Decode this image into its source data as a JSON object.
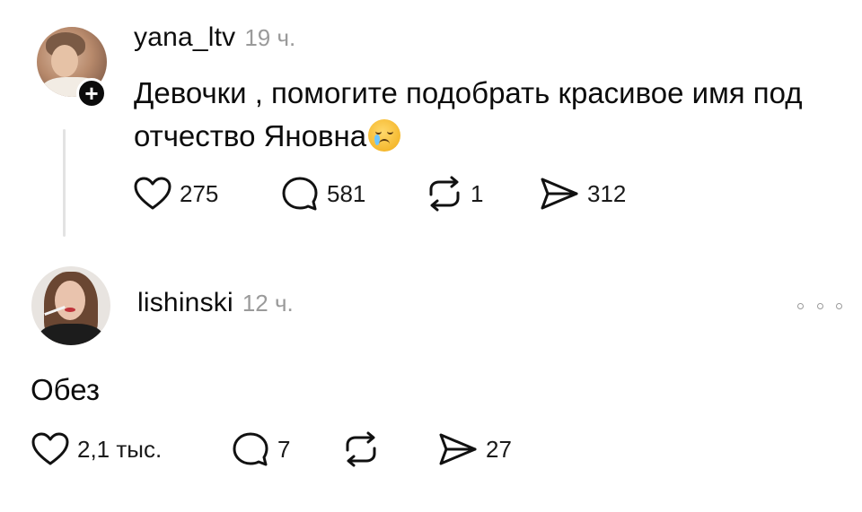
{
  "posts": [
    {
      "username": "yana_ltv",
      "time": "19 ч.",
      "text": "Девочки , помогите подобрать красивое имя под отчество Яновна",
      "emoji": "crying-face-emoji",
      "likes": "275",
      "comments": "581",
      "reposts": "1",
      "shares": "312"
    },
    {
      "username": "lishinski",
      "time": "12 ч.",
      "text": "Обез",
      "likes": "2,1 тыс.",
      "comments": "7",
      "reposts": "",
      "shares": "27"
    }
  ],
  "icons": {
    "like": "heart-icon",
    "comment": "comment-bubble-icon",
    "repost": "repost-icon",
    "share": "send-icon",
    "follow": "plus-icon",
    "more": "more-dots-icon"
  },
  "colors": {
    "text": "#0c0c0c",
    "muted": "#9a9a9a",
    "thread_line": "#e3e3e3",
    "background": "#ffffff"
  }
}
